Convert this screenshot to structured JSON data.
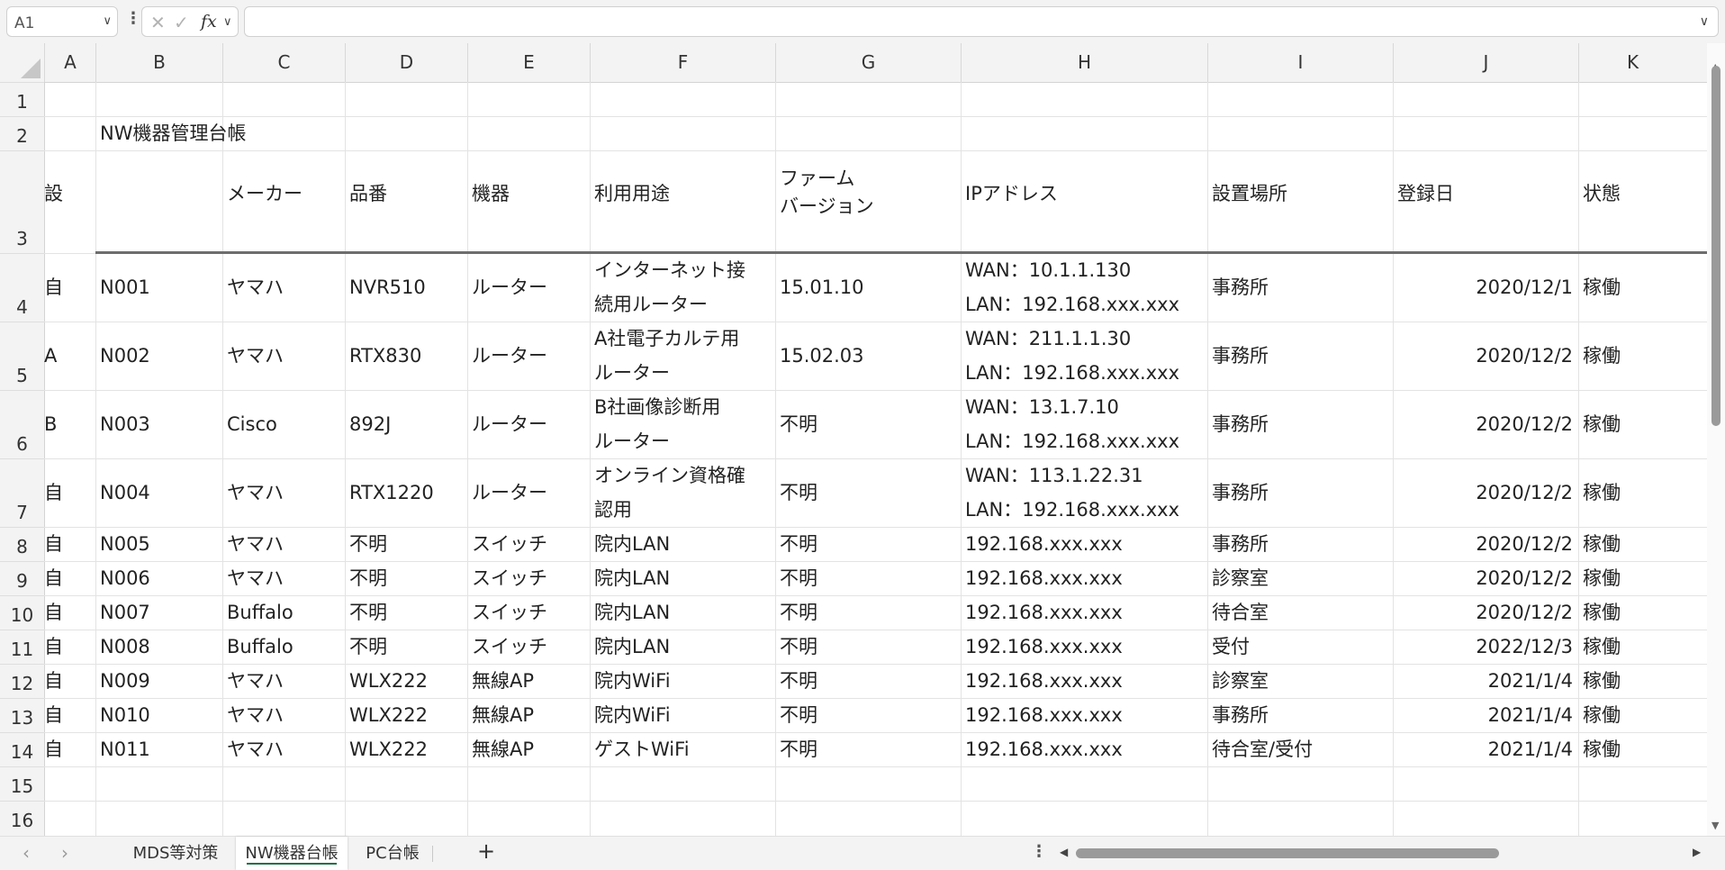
{
  "formula_bar": {
    "name_box": "A1",
    "formula": "",
    "icons": [
      "cancel-icon",
      "enter-check-icon",
      "insert-function-icon"
    ]
  },
  "columns": [
    "A",
    "B",
    "C",
    "D",
    "E",
    "F",
    "G",
    "H",
    "I",
    "J",
    "K"
  ],
  "rows": [
    "1",
    "2",
    "3",
    "4",
    "5",
    "6",
    "7",
    "8",
    "9",
    "10",
    "11",
    "12",
    "13",
    "14",
    "15",
    "16"
  ],
  "sheet": {
    "title": "NW機器管理台帳",
    "headers": {
      "maker": "メーカー",
      "model": "品番",
      "device": "機器",
      "purpose": "利用用途",
      "firmware": [
        "ファーム",
        "バージョン"
      ],
      "ip": "IPアドレス",
      "location": "設置場所",
      "registered": "登録日",
      "status": "状態",
      "extra": "設"
    },
    "records": [
      {
        "id": "N001",
        "maker": "ヤマハ",
        "model": "NVR510",
        "device": "ルーター",
        "purpose": [
          "インターネット接",
          "続用ルーター"
        ],
        "fw": "15.01.10",
        "ip": [
          "WAN：10.1.1.130",
          "LAN：192.168.xxx.xxx"
        ],
        "loc": "事務所",
        "date": "2020/12/1",
        "status": "稼働",
        "extra": "自"
      },
      {
        "id": "N002",
        "maker": "ヤマハ",
        "model": "RTX830",
        "device": "ルーター",
        "purpose": [
          "A社電子カルテ用",
          "ルーター"
        ],
        "fw": "15.02.03",
        "ip": [
          "WAN：211.1.1.30",
          "LAN：192.168.xxx.xxx"
        ],
        "loc": "事務所",
        "date": "2020/12/2",
        "status": "稼働",
        "extra": "A"
      },
      {
        "id": "N003",
        "maker": "Cisco",
        "model": "892J",
        "device": "ルーター",
        "purpose": [
          "B社画像診断用",
          "ルーター"
        ],
        "fw": "不明",
        "ip": [
          "WAN：13.1.7.10",
          "LAN：192.168.xxx.xxx"
        ],
        "loc": "事務所",
        "date": "2020/12/2",
        "status": "稼働",
        "extra": "B"
      },
      {
        "id": "N004",
        "maker": "ヤマハ",
        "model": "RTX1220",
        "device": "ルーター",
        "purpose": [
          "オンライン資格確",
          "認用"
        ],
        "fw": "不明",
        "ip": [
          "WAN：113.1.22.31",
          "LAN：192.168.xxx.xxx"
        ],
        "loc": "事務所",
        "date": "2020/12/2",
        "status": "稼働",
        "extra": "自"
      },
      {
        "id": "N005",
        "maker": "ヤマハ",
        "model": "不明",
        "device": "スイッチ",
        "purpose": [
          "院内LAN"
        ],
        "fw": "不明",
        "ip": [
          "192.168.xxx.xxx"
        ],
        "loc": "事務所",
        "date": "2020/12/2",
        "status": "稼働",
        "extra": "自"
      },
      {
        "id": "N006",
        "maker": "ヤマハ",
        "model": "不明",
        "device": "スイッチ",
        "purpose": [
          "院内LAN"
        ],
        "fw": "不明",
        "ip": [
          "192.168.xxx.xxx"
        ],
        "loc": "診察室",
        "date": "2020/12/2",
        "status": "稼働",
        "extra": "自"
      },
      {
        "id": "N007",
        "maker": "Buffalo",
        "model": "不明",
        "device": "スイッチ",
        "purpose": [
          "院内LAN"
        ],
        "fw": "不明",
        "ip": [
          "192.168.xxx.xxx"
        ],
        "loc": "待合室",
        "date": "2020/12/2",
        "status": "稼働",
        "extra": "自"
      },
      {
        "id": "N008",
        "maker": "Buffalo",
        "model": "不明",
        "device": "スイッチ",
        "purpose": [
          "院内LAN"
        ],
        "fw": "不明",
        "ip": [
          "192.168.xxx.xxx"
        ],
        "loc": "受付",
        "date": "2022/12/3",
        "status": "稼働",
        "extra": "自"
      },
      {
        "id": "N009",
        "maker": "ヤマハ",
        "model": "WLX222",
        "device": "無線AP",
        "purpose": [
          "院内WiFi"
        ],
        "fw": "不明",
        "ip": [
          "192.168.xxx.xxx"
        ],
        "loc": "診察室",
        "date": "2021/1/4",
        "status": "稼働",
        "extra": "自"
      },
      {
        "id": "N010",
        "maker": "ヤマハ",
        "model": "WLX222",
        "device": "無線AP",
        "purpose": [
          "院内WiFi"
        ],
        "fw": "不明",
        "ip": [
          "192.168.xxx.xxx"
        ],
        "loc": "事務所",
        "date": "2021/1/4",
        "status": "稼働",
        "extra": "自"
      },
      {
        "id": "N011",
        "maker": "ヤマハ",
        "model": "WLX222",
        "device": "無線AP",
        "purpose": [
          "ゲストWiFi"
        ],
        "fw": "不明",
        "ip": [
          "192.168.xxx.xxx"
        ],
        "loc": "待合室/受付",
        "date": "2021/1/4",
        "status": "稼働",
        "extra": "自"
      }
    ]
  },
  "tabs": [
    {
      "label": "MDS等対策",
      "active": false
    },
    {
      "label": "NW機器台帳",
      "active": true
    },
    {
      "label": "PC台帳",
      "active": false
    }
  ],
  "colors": {
    "accent": "#1e7145",
    "header_bg": "#f3f3f3",
    "grid_line": "#e3e3e3",
    "thick_border": "#6d6d6d"
  }
}
